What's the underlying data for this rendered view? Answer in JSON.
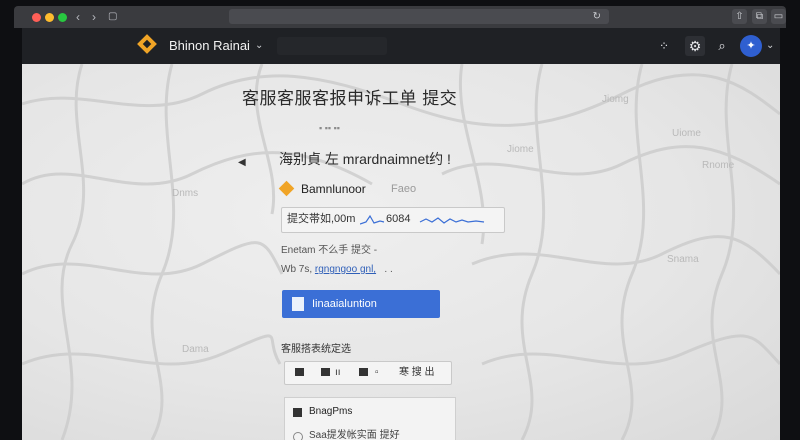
{
  "app": {
    "workspace_name": "Bhinon Rainai",
    "colors": {
      "accent": "#3b6fd6",
      "brand": "#f0a426",
      "header": "#1f2125"
    }
  },
  "page": {
    "title": "客服客服客报申诉工单 提交",
    "heading": "海别貞 左 mrardnaimnet约 !",
    "brand_name": "Bamnlunoor",
    "brand_tag": "Faeo",
    "metric_label": "提交帯如,00m",
    "metric_value": "6084",
    "field_label": "Enetam 不么手 提交 -",
    "link_prefix": "Wb 7s,",
    "link_text": "rgngngoo gnl,",
    "primary_button": "Iinaaialuntion",
    "section2_title": "客服搭表统定选",
    "toolbar_item_last": "寒 搜 出",
    "card_title": "BnagPms",
    "card_sub": "Saa提发帐实面 提好"
  },
  "watermarks": [
    "Jiomg",
    "Uiome",
    "Jiome",
    "Rnome",
    "Dnms",
    "Snama",
    "Dama"
  ]
}
